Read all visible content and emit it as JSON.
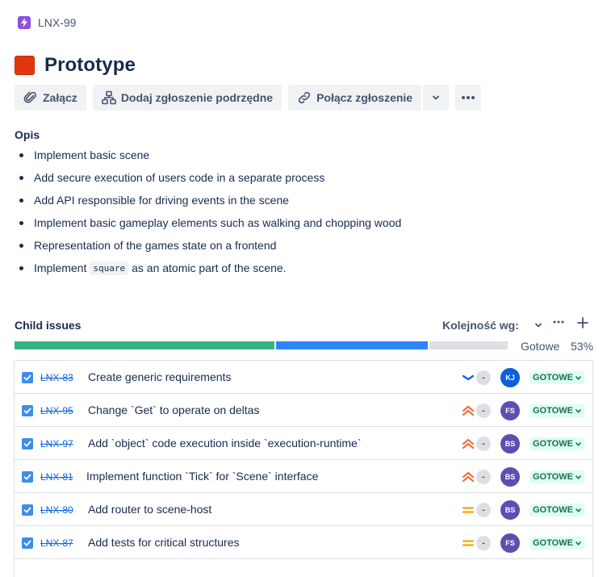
{
  "breadcrumb": {
    "key": "LNX-99",
    "icon": "lightning-icon",
    "icon_color": "#904ee2"
  },
  "issue": {
    "title": "Prototype",
    "epic_color": "#e2360c"
  },
  "toolbar": {
    "attach_label": "Załącz",
    "add_child_label": "Dodaj zgłoszenie podrzędne",
    "link_label": "Połącz zgłoszenie"
  },
  "description": {
    "heading": "Opis",
    "items": [
      {
        "text": "Implement basic scene"
      },
      {
        "text": "Add secure execution of users code in a separate process"
      },
      {
        "text": "Add API responsible for driving events in the scene"
      },
      {
        "text": "Implement basic gameplay elements such as walking and chopping wood"
      },
      {
        "text": "Representation of the games state on a frontend"
      },
      {
        "pre": "Implement",
        "code": "square",
        "post": "as an atomic part of the scene."
      }
    ]
  },
  "child_issues": {
    "title": "Child issues",
    "sort_label": "Kolejność wg:",
    "progress": {
      "label": "Gotowe",
      "percent": "53%",
      "segments": [
        {
          "fraction": 0.53,
          "color": "#36b37e"
        },
        {
          "fraction": 0.31,
          "color": "#2d86f7"
        },
        {
          "fraction": 0.16,
          "color": "#dcdfe4"
        }
      ]
    },
    "issues": [
      {
        "key": "LNX-83",
        "summary": "Create generic requirements",
        "priority": "lowest",
        "estimate": "-",
        "assignee": "KJ",
        "assignee_color": "#0c5fd7",
        "status": "GOTOWE"
      },
      {
        "key": "LNX-95",
        "summary": "Change `Get` to operate on deltas",
        "priority": "highest",
        "estimate": "-",
        "assignee": "FS",
        "assignee_color": "#5e4db2",
        "status": "GOTOWE"
      },
      {
        "key": "LNX-97",
        "summary": "Add `object` code execution inside `execution-runtime`",
        "priority": "highest",
        "estimate": "-",
        "assignee": "BS",
        "assignee_color": "#5e4db2",
        "status": "GOTOWE"
      },
      {
        "key": "LNX-81",
        "summary": "Implement function `Tick` for `Scene` interface",
        "priority": "highest",
        "estimate": "-",
        "assignee": "BS",
        "assignee_color": "#5e4db2",
        "status": "GOTOWE"
      },
      {
        "key": "LNX-80",
        "summary": "Add router to scene-host",
        "priority": "medium",
        "estimate": "-",
        "assignee": "BS",
        "assignee_color": "#5e4db2",
        "status": "GOTOWE"
      },
      {
        "key": "LNX-87",
        "summary": "Add tests for critical structures",
        "priority": "medium",
        "estimate": "-",
        "assignee": "FS",
        "assignee_color": "#5e4db2",
        "status": "GOTOWE"
      }
    ],
    "priority_colors": {
      "lowest": "#0c66e4",
      "highest": "#f4703f",
      "medium": "#f7a600"
    }
  }
}
